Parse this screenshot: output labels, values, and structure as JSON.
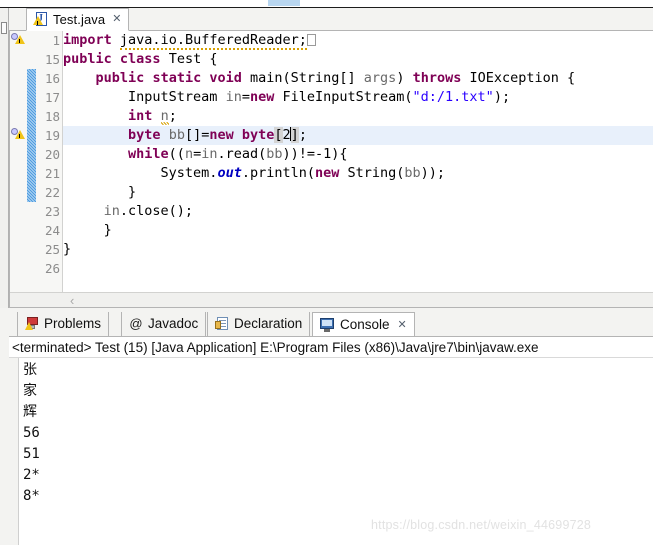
{
  "window": {
    "app": "Eclipse IDE"
  },
  "editor": {
    "tab": {
      "title": "Test.java",
      "close_glyph": "✕",
      "icon": "java-file-warning-icon"
    },
    "gutter": {
      "line_numbers": [
        "1",
        "15",
        "16",
        "17",
        "18",
        "19",
        "20",
        "21",
        "22",
        "23",
        "24",
        "25",
        "26"
      ]
    },
    "scroll": {
      "left_arrow": "‹"
    },
    "lines": [
      {
        "number": "1",
        "tokens": [
          {
            "t": "import",
            "c": "kw"
          },
          {
            "t": " ",
            "c": "pln"
          },
          {
            "t": "java.io.BufferedReader;",
            "c": "pln spell"
          }
        ]
      },
      {
        "number": "15",
        "tokens": [
          {
            "t": "public",
            "c": "kw"
          },
          {
            "t": " ",
            "c": "pln"
          },
          {
            "t": "class",
            "c": "kw"
          },
          {
            "t": " Test {",
            "c": "pln"
          }
        ]
      },
      {
        "number": "16",
        "tokens": [
          {
            "t": "    ",
            "c": "pln"
          },
          {
            "t": "public",
            "c": "kw"
          },
          {
            "t": " ",
            "c": "pln"
          },
          {
            "t": "static",
            "c": "kw"
          },
          {
            "t": " ",
            "c": "pln"
          },
          {
            "t": "void",
            "c": "kw"
          },
          {
            "t": " main(String[] ",
            "c": "pln"
          },
          {
            "t": "args",
            "c": "loc"
          },
          {
            "t": ") ",
            "c": "pln"
          },
          {
            "t": "throws",
            "c": "kw"
          },
          {
            "t": " IOException {",
            "c": "pln"
          }
        ]
      },
      {
        "number": "17",
        "tokens": [
          {
            "t": "        InputStream ",
            "c": "pln"
          },
          {
            "t": "in",
            "c": "loc"
          },
          {
            "t": "=",
            "c": "pln"
          },
          {
            "t": "new",
            "c": "kw"
          },
          {
            "t": " FileInputStream(",
            "c": "pln"
          },
          {
            "t": "\"d:/1.txt\"",
            "c": "str"
          },
          {
            "t": ");",
            "c": "pln"
          }
        ]
      },
      {
        "number": "18",
        "tokens": [
          {
            "t": "        ",
            "c": "pln"
          },
          {
            "t": "int",
            "c": "kw"
          },
          {
            "t": " ",
            "c": "pln"
          },
          {
            "t": "n",
            "c": "loc underline-warn"
          },
          {
            "t": ";",
            "c": "pln"
          }
        ]
      },
      {
        "number": "19",
        "highlight": true,
        "tokens": [
          {
            "t": "        ",
            "c": "pln"
          },
          {
            "t": "byte",
            "c": "kw"
          },
          {
            "t": " ",
            "c": "pln"
          },
          {
            "t": "bb",
            "c": "loc"
          },
          {
            "t": "[]=",
            "c": "pln"
          },
          {
            "t": "new",
            "c": "kw"
          },
          {
            "t": " ",
            "c": "pln"
          },
          {
            "t": "byte",
            "c": "kw"
          },
          {
            "t": "[",
            "c": "pln occ-box"
          },
          {
            "t": "2",
            "c": "num"
          },
          {
            "t": "|caret|",
            "c": "caret"
          },
          {
            "t": "]",
            "c": "pln occ-box"
          },
          {
            "t": ";",
            "c": "pln"
          }
        ]
      },
      {
        "number": "20",
        "tokens": [
          {
            "t": "        ",
            "c": "pln"
          },
          {
            "t": "while",
            "c": "kw"
          },
          {
            "t": "((",
            "c": "pln"
          },
          {
            "t": "n",
            "c": "loc"
          },
          {
            "t": "=",
            "c": "pln"
          },
          {
            "t": "in",
            "c": "loc"
          },
          {
            "t": ".read(",
            "c": "pln"
          },
          {
            "t": "bb",
            "c": "loc"
          },
          {
            "t": "))!=-1){",
            "c": "pln"
          }
        ]
      },
      {
        "number": "21",
        "tokens": [
          {
            "t": "            System.",
            "c": "pln"
          },
          {
            "t": "out",
            "c": "fld"
          },
          {
            "t": ".println(",
            "c": "pln"
          },
          {
            "t": "new",
            "c": "kw"
          },
          {
            "t": " String(",
            "c": "pln"
          },
          {
            "t": "bb",
            "c": "loc"
          },
          {
            "t": "));",
            "c": "pln"
          }
        ]
      },
      {
        "number": "22",
        "tokens": [
          {
            "t": "        }",
            "c": "pln"
          }
        ]
      },
      {
        "number": "23",
        "tokens": [
          {
            "t": "     ",
            "c": "pln"
          },
          {
            "t": "in",
            "c": "loc"
          },
          {
            "t": ".close();",
            "c": "pln"
          }
        ]
      },
      {
        "number": "24",
        "tokens": [
          {
            "t": "     }",
            "c": "pln"
          }
        ]
      },
      {
        "number": "25",
        "tokens": [
          {
            "t": "}",
            "c": "pln"
          }
        ]
      },
      {
        "number": "26",
        "tokens": []
      }
    ]
  },
  "bottom_view": {
    "tabs": [
      {
        "label": "Problems",
        "icon": "problems-icon",
        "active": false,
        "closable": false
      },
      {
        "label": "Javadoc",
        "icon": "javadoc-at-icon",
        "active": false,
        "closable": false
      },
      {
        "label": "Declaration",
        "icon": "declaration-icon",
        "active": false,
        "closable": false
      },
      {
        "label": "Console",
        "icon": "console-icon",
        "active": true,
        "closable": true,
        "close_glyph": "✕"
      }
    ],
    "console": {
      "terminated_line": "<terminated> Test (15) [Java Application] E:\\Program Files (x86)\\Java\\jre7\\bin\\javaw.exe",
      "output_lines": [
        "张",
        "家",
        "辉",
        "56",
        "51",
        "2*",
        "8*"
      ]
    }
  },
  "watermark": "https://blog.csdn.net/weixin_44699728",
  "colors": {
    "keyword": "#7f0055",
    "string": "#2a00ff",
    "field": "#0000c0",
    "local_var": "#6a6a6a",
    "line_highlight": "#e8f0fb",
    "change_bar": "#4f9de0",
    "tab_border": "#b4b4b4"
  }
}
